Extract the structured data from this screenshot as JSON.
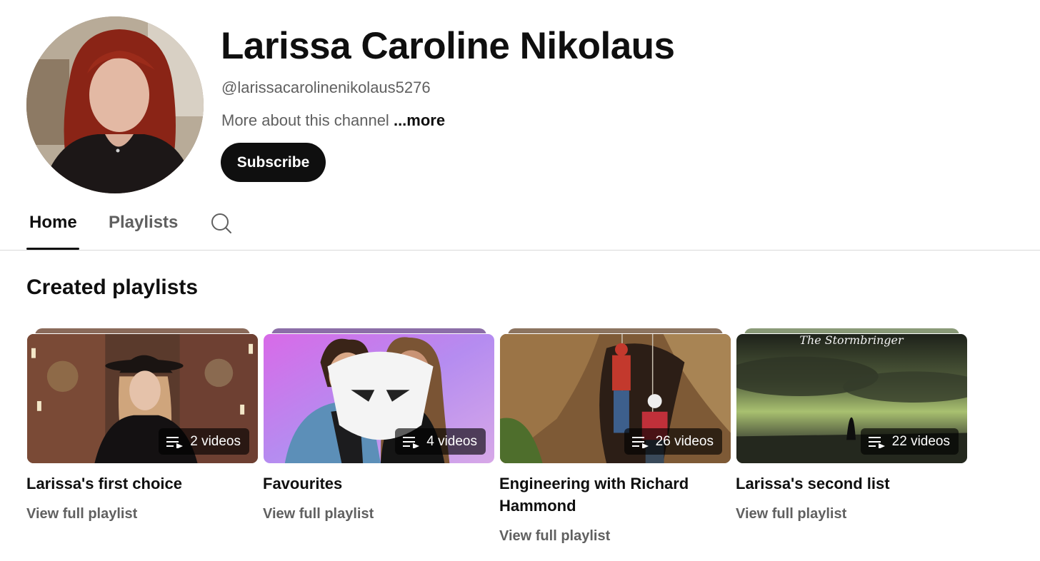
{
  "channel": {
    "name": "Larissa Caroline Nikolaus",
    "handle": "@larissacarolinenikolaus5276",
    "about_text": "More about this channel",
    "more_label": "...more",
    "subscribe_label": "Subscribe"
  },
  "tabs": [
    {
      "label": "Home",
      "active": true
    },
    {
      "label": "Playlists",
      "active": false
    }
  ],
  "section": {
    "title": "Created playlists"
  },
  "playlists": [
    {
      "title": "Larissa's first choice",
      "count": "2 videos",
      "link": "View full playlist",
      "thumb_caption": ""
    },
    {
      "title": "Favourites",
      "count": "4 videos",
      "link": "View full playlist",
      "thumb_caption": ""
    },
    {
      "title": "Engineering with Richard Hammond",
      "count": "26 videos",
      "link": "View full playlist",
      "thumb_caption": ""
    },
    {
      "title": "Larissa's second list",
      "count": "22 videos",
      "link": "View full playlist",
      "thumb_caption": "The Stormbringer"
    }
  ],
  "colors": {
    "text_primary": "#0f0f0f",
    "text_secondary": "#606060",
    "subscribe_bg": "#0f0f0f",
    "divider": "#d9d9d9"
  },
  "icons": {
    "search": "search-icon",
    "playlist": "playlist-icon",
    "app_badge": "grindr-icon"
  }
}
